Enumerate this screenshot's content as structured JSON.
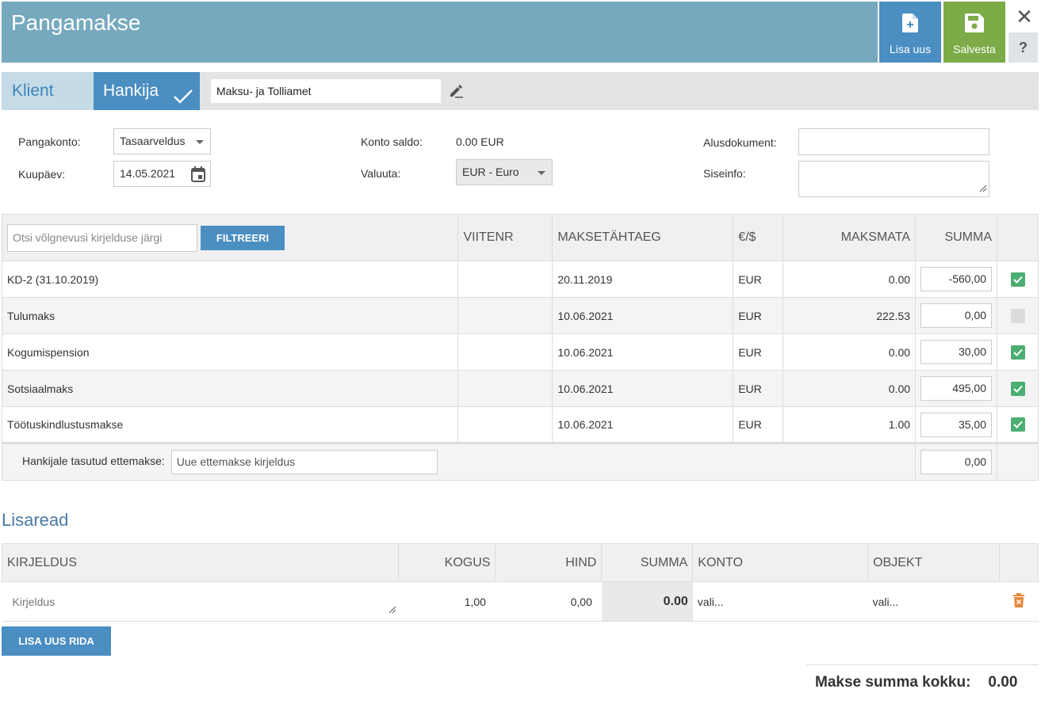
{
  "header": {
    "title": "Pangamakse",
    "new_label": "Lisa uus",
    "save_label": "Salvesta",
    "close_glyph": "✕",
    "help_glyph": "?"
  },
  "party": {
    "tab_client": "Klient",
    "tab_supplier": "Hankija",
    "supplier_name": "Maksu- ja Tolliamet"
  },
  "form": {
    "bank_account_label": "Pangakonto:",
    "bank_account_value": "Tasaarveldus",
    "date_label": "Kuupäev:",
    "date_value": "14.05.2021",
    "balance_label": "Konto saldo:",
    "balance_value": "0.00 EUR",
    "currency_label": "Valuuta:",
    "currency_value": "EUR - Euro",
    "base_doc_label": "Alusdokument:",
    "base_doc_value": "",
    "internal_label": "Siseinfo:",
    "internal_value": ""
  },
  "debts": {
    "search_placeholder": "Otsi võlgnevusi kirjelduse järgi",
    "filter_label": "FILTREERI",
    "columns": {
      "ref": "VIITENR",
      "due": "MAKSETÄHTAEG",
      "cur": "€/$",
      "unpaid": "MAKSMATA",
      "sum": "SUMMA"
    },
    "rows": [
      {
        "desc": "KD-2 (31.10.2019)",
        "ref": "",
        "due": "20.11.2019",
        "cur": "EUR",
        "unpaid": "0.00",
        "sum": "-560,00",
        "checked": true
      },
      {
        "desc": "Tulumaks",
        "ref": "",
        "due": "10.06.2021",
        "cur": "EUR",
        "unpaid": "222.53",
        "sum": "0,00",
        "checked": false
      },
      {
        "desc": "Kogumispension",
        "ref": "",
        "due": "10.06.2021",
        "cur": "EUR",
        "unpaid": "0.00",
        "sum": "30,00",
        "checked": true
      },
      {
        "desc": "Sotsiaalmaks",
        "ref": "",
        "due": "10.06.2021",
        "cur": "EUR",
        "unpaid": "0.00",
        "sum": "495,00",
        "checked": true
      },
      {
        "desc": "Töötuskindlustusmakse",
        "ref": "",
        "due": "10.06.2021",
        "cur": "EUR",
        "unpaid": "1.00",
        "sum": "35,00",
        "checked": true
      }
    ],
    "prepay_label": "Hankijale tasutud ettemakse:",
    "prepay_placeholder": "Uue ettemakse kirjeldus",
    "prepay_sum": "0,00"
  },
  "extra": {
    "title": "Lisaread",
    "columns": {
      "desc": "KIRJELDUS",
      "qty": "KOGUS",
      "price": "HIND",
      "sum": "SUMMA",
      "account": "KONTO",
      "object": "OBJEKT"
    },
    "row": {
      "desc_placeholder": "Kirjeldus",
      "qty": "1,00",
      "price": "0,00",
      "sum": "0.00",
      "account": "vali...",
      "object": "vali..."
    },
    "add_label": "LISA UUS RIDA"
  },
  "total": {
    "label": "Makse summa kokku:",
    "value": "0.00"
  },
  "colors": {
    "header": "#76a9be",
    "primary": "#4a8ec2",
    "save": "#7cab48",
    "check": "#4cae72",
    "delete": "#e8883a"
  }
}
